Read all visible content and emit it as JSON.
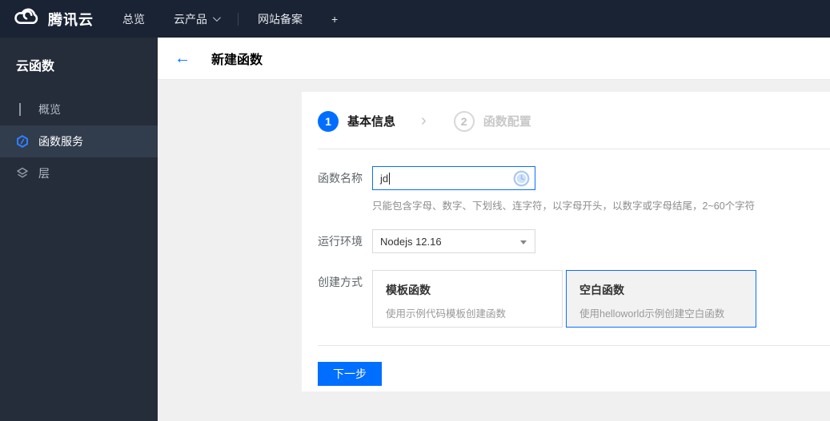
{
  "colors": {
    "accent": "#006eff",
    "topbar_bg": "#1a2334",
    "sidebar_bg": "#252c3a",
    "sidebar_selected_bg": "#313c4d"
  },
  "topbar": {
    "brand": "腾讯云",
    "nav": [
      {
        "label": "总览"
      },
      {
        "label": "云产品"
      },
      {
        "label": "网站备案"
      },
      {
        "label": "+"
      }
    ]
  },
  "sidebar": {
    "title": "云函数",
    "items": [
      {
        "label": "概览",
        "icon": "grid-icon",
        "selected": false
      },
      {
        "label": "函数服务",
        "icon": "function-icon",
        "selected": true
      },
      {
        "label": "层",
        "icon": "layers-icon",
        "selected": false
      }
    ]
  },
  "header": {
    "back": "←",
    "title": "新建函数"
  },
  "wizard": {
    "steps": [
      {
        "number": "1",
        "label": "基本信息",
        "active": true
      },
      {
        "number": "2",
        "label": "函数配置",
        "active": false
      }
    ],
    "chevron": "›"
  },
  "form": {
    "name": {
      "label": "函数名称",
      "value": "jd",
      "status_icon": "clock-pending-icon",
      "hint": "只能包含字母、数字、下划线、连字符，以字母开头，以数字或字母结尾，2~60个字符"
    },
    "runtime": {
      "label": "运行环境",
      "value": "Nodejs 12.16"
    },
    "method": {
      "label": "创建方式",
      "options": [
        {
          "title": "模板函数",
          "desc": "使用示例代码模板创建函数",
          "selected": false
        },
        {
          "title": "空白函数",
          "desc": "使用helloworld示例创建空白函数",
          "selected": true
        }
      ]
    }
  },
  "actions": {
    "next": "下一步"
  }
}
